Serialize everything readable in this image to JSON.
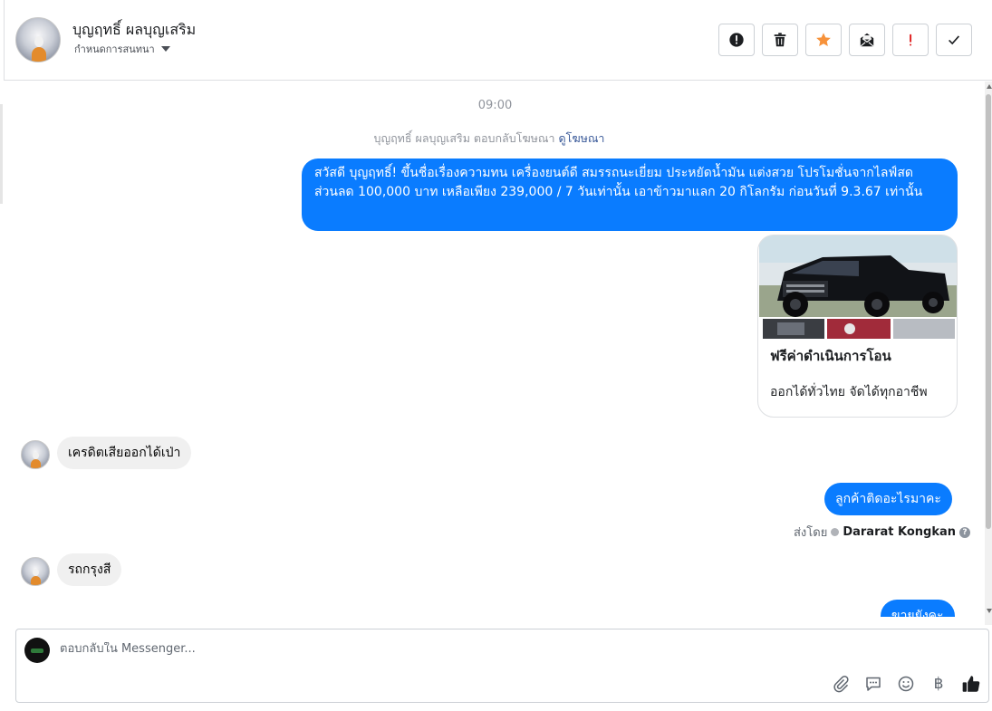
{
  "header": {
    "contact_name": "บุญฤทธิ์ ผลบุญเสริม",
    "status_label": "กำหนดการสนทนา",
    "actions": [
      {
        "name": "report-button",
        "icon": "alert-circle-icon"
      },
      {
        "name": "delete-button",
        "icon": "trash-icon"
      },
      {
        "name": "star-button",
        "icon": "star-icon"
      },
      {
        "name": "mark-unread-button",
        "icon": "envelope-icon"
      },
      {
        "name": "important-button",
        "icon": "exclamation-icon"
      },
      {
        "name": "done-button",
        "icon": "check-icon"
      }
    ]
  },
  "conversation": {
    "timestamp": "09:00",
    "ad_reply_prefix": "บุญฤทธิ์ ผลบุญเสริม ตอบกลับโฆษณา",
    "ad_reply_link": "ดูโฆษณา",
    "messages": [
      {
        "from": "page",
        "text": "สวัสดี บุญฤทธิ์! ขึ้นชื่อเรื่องความทน เครื่องยนต์ดี สมรรถนะเยี่ยม ประหยัดน้ำมัน แต่งสวย โปรโมชั่นจากไลฟ์สด ส่วนลด 100,000 บาท เหลือเพียง 239,000 / 7 วันเท่านั้น เอาข้าวมาแลก 20 กิโลกรัม ก่อนวันที่ 9.3.67 เท่านั้น"
      },
      {
        "from": "user",
        "text": "เครดิตเสียออกได้เป่า"
      },
      {
        "from": "page",
        "text": "ลูกค้าติดอะไรมาคะ"
      },
      {
        "from": "user",
        "text": "รถกรุงสี"
      },
      {
        "from": "page",
        "text": "ขายยังคะ"
      }
    ],
    "card": {
      "title": "ฟรีค่าดำเนินการโอน",
      "subtitle": "ออกได้ทั่วไทย จัดได้ทุกอาชีพ"
    },
    "sent_by_label": "ส่งโดย",
    "sent_by_agent": "Dararat Kongkan"
  },
  "composer": {
    "placeholder": "ตอบกลับใน Messenger...",
    "currency_symbol": "฿",
    "icons": [
      "paperclip-icon",
      "saved-replies-icon",
      "emoji-icon",
      "baht-icon",
      "thumbs-up-icon"
    ]
  },
  "colors": {
    "outgoing_bubble": "#0a7cff",
    "incoming_bubble": "#f0f0f0",
    "star": "#f7923a",
    "important": "#e02020"
  }
}
